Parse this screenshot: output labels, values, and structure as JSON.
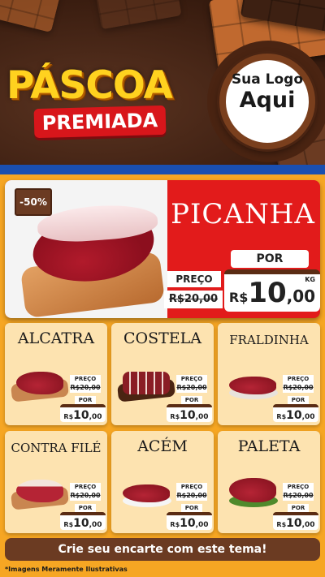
{
  "header": {
    "title_main": "PÁSCOA",
    "title_sub": "PREMIADA",
    "logo_line1": "Sua Logo",
    "logo_line2": "Aqui"
  },
  "hero": {
    "product": "PICANHA",
    "discount": "-50%",
    "por_label": "POR",
    "preco_label": "PREÇO",
    "old_price": "R$20,00",
    "new_price_currency": "R$",
    "new_price_int": "10",
    "new_price_dec": ",00",
    "unit": "KG"
  },
  "products": [
    {
      "name": "ALCATRA",
      "preco_label": "PREÇO",
      "old_price": "R$20,00",
      "por_label": "POR",
      "currency": "R$",
      "price_int": "10",
      "price_dec": ",00"
    },
    {
      "name": "COSTELA",
      "preco_label": "PREÇO",
      "old_price": "R$20,00",
      "por_label": "POR",
      "currency": "R$",
      "price_int": "10",
      "price_dec": ",00"
    },
    {
      "name": "FRALDINHA",
      "preco_label": "PREÇO",
      "old_price": "R$20,00",
      "por_label": "POR",
      "currency": "R$",
      "price_int": "10",
      "price_dec": ",00"
    },
    {
      "name": "CONTRA FILÉ",
      "preco_label": "PREÇO",
      "old_price": "R$20,00",
      "por_label": "POR",
      "currency": "R$",
      "price_int": "10",
      "price_dec": ",00"
    },
    {
      "name": "ACÉM",
      "preco_label": "PREÇO",
      "old_price": "R$20,00",
      "por_label": "POR",
      "currency": "R$",
      "price_int": "10",
      "price_dec": ",00"
    },
    {
      "name": "PALETA",
      "preco_label": "PREÇO",
      "old_price": "R$20,00",
      "por_label": "POR",
      "currency": "R$",
      "price_int": "10",
      "price_dec": ",00"
    }
  ],
  "footer": {
    "cta": "Crie seu encarte com este tema!",
    "disclaimer": "*Imagens Meramente Ilustrativas"
  },
  "colors": {
    "background": "#f6a623",
    "hero_red": "#e21b1b",
    "chocolate": "#6b3b22",
    "title_yellow": "#ffd21f",
    "premiada_red": "#d8161b",
    "band_blue": "#1a4fb0"
  }
}
